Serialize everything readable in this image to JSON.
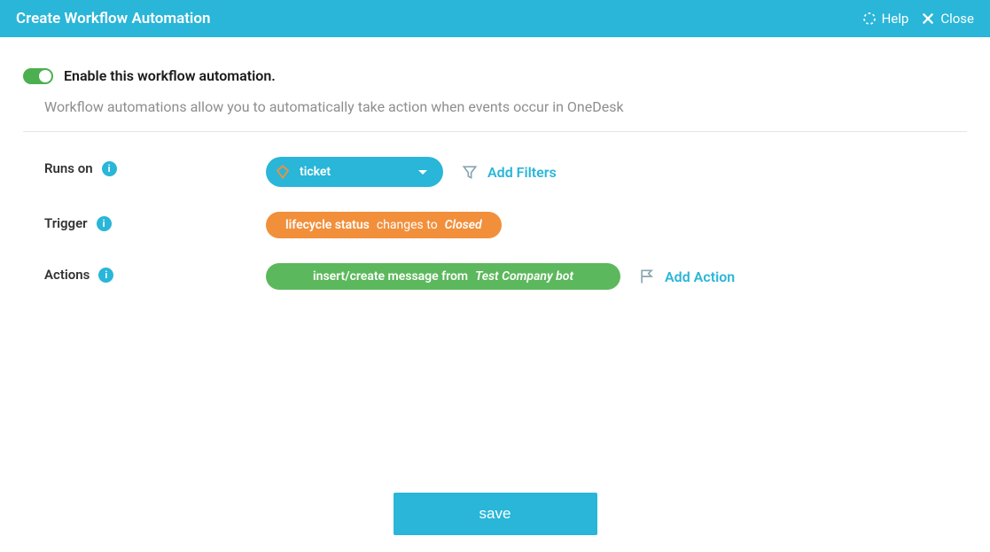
{
  "header": {
    "title": "Create Workflow Automation",
    "help": "Help",
    "close": "Close"
  },
  "enable": {
    "label": "Enable this workflow automation.",
    "value": true
  },
  "description": "Workflow automations allow you to automatically take action when events occur in OneDesk",
  "runsOn": {
    "label": "Runs on",
    "selected": "ticket",
    "addFilters": "Add Filters"
  },
  "trigger": {
    "label": "Trigger",
    "field": "lifecycle status",
    "operator": "changes to",
    "value": "Closed"
  },
  "actions": {
    "label": "Actions",
    "actionText": "insert/create message from",
    "actionValue": "Test Company bot",
    "addAction": "Add Action"
  },
  "save": "save"
}
